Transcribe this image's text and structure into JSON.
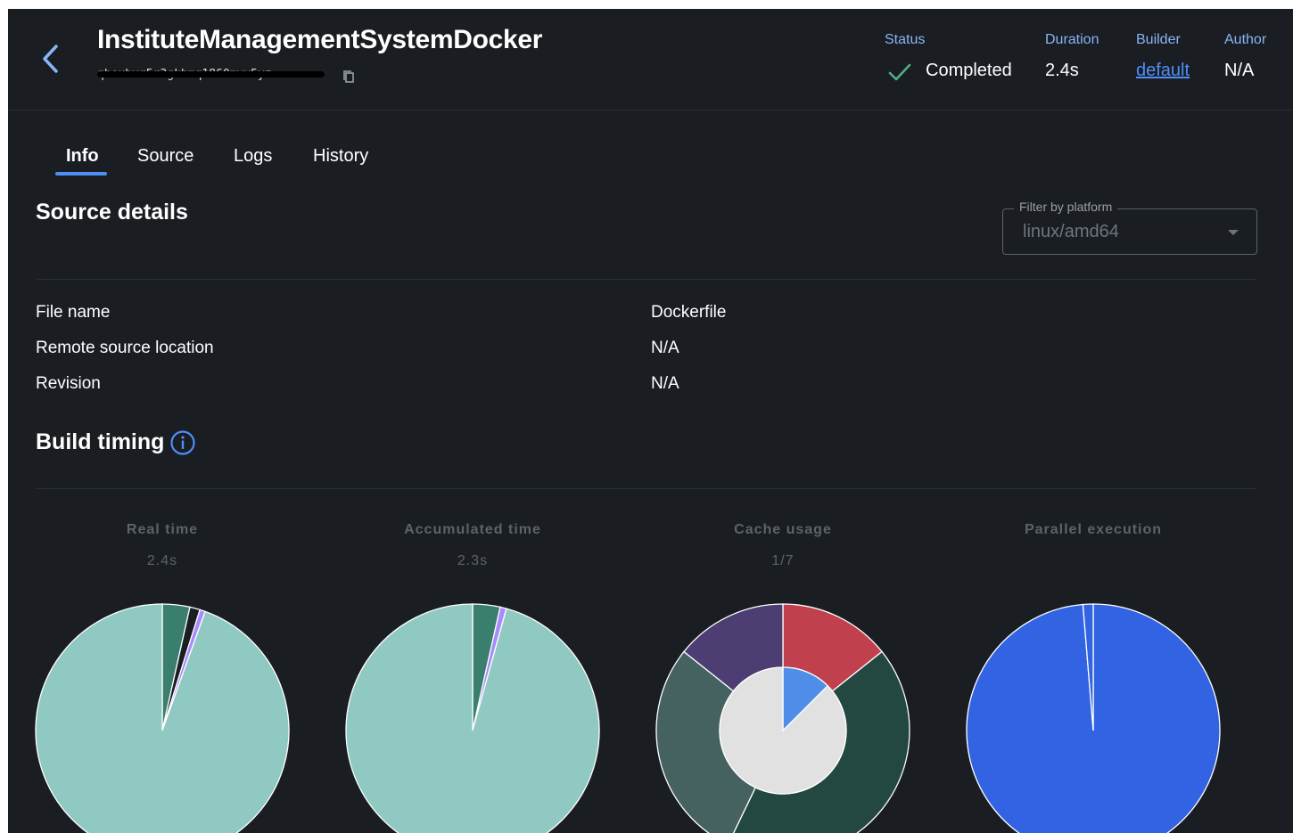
{
  "header": {
    "title": "InstituteManagementSystemDocker",
    "digest": "qheubvr5r3gkhmq1860mvv5yz",
    "status_label": "Status",
    "status_value": "Completed",
    "duration_label": "Duration",
    "duration_value": "2.4s",
    "builder_label": "Builder",
    "builder_value": "default",
    "author_label": "Author",
    "author_value": "N/A"
  },
  "tabs": [
    "Info",
    "Source",
    "Logs",
    "History"
  ],
  "source": {
    "title": "Source details",
    "filter_label": "Filter by platform",
    "filter_value": "linux/amd64",
    "rows": [
      {
        "label": "File name",
        "value": "Dockerfile"
      },
      {
        "label": "Remote source location",
        "value": "N/A"
      },
      {
        "label": "Revision",
        "value": "N/A"
      }
    ]
  },
  "timing": {
    "title": "Build timing",
    "charts": [
      {
        "title": "Real time",
        "value": "2.4s"
      },
      {
        "title": "Accumulated time",
        "value": "2.3s"
      },
      {
        "title": "Cache usage",
        "value": "1/7"
      },
      {
        "title": "Parallel execution",
        "value": ""
      }
    ]
  },
  "chart_data": [
    {
      "type": "pie",
      "title": "Real time",
      "values": [
        0.035,
        0.013,
        0.007,
        0.945
      ],
      "colors": [
        "#3a7f6d",
        "#1a1d22",
        "#a78bfa",
        "#8fc9c1"
      ]
    },
    {
      "type": "pie",
      "title": "Accumulated time",
      "values": [
        0.035,
        0.008,
        0.957
      ],
      "colors": [
        "#3a7f6d",
        "#a78bfa",
        "#8fc9c1"
      ]
    },
    {
      "type": "pie",
      "title": "Cache usage",
      "outer": {
        "values": [
          1,
          3,
          2,
          1
        ],
        "colors": [
          "#c0414d",
          "#234741",
          "#456160",
          "#4c3e72"
        ]
      },
      "inner": {
        "values": [
          1,
          7
        ],
        "colors": [
          "#4f8ee8",
          "#e1e1e1"
        ]
      }
    },
    {
      "type": "pie",
      "title": "Parallel execution",
      "values": [
        0.987,
        0.013
      ],
      "colors": [
        "#3163e2",
        "#3163e2"
      ]
    }
  ],
  "colors": {
    "accent": "#4f8ef7",
    "success": "#4caf85",
    "background": "#1a1d22"
  },
  "icons": {
    "back": "chevron-left-icon",
    "copy": "copy-icon",
    "status": "check-icon",
    "info": "info-icon",
    "dropdown": "caret-down-icon"
  }
}
